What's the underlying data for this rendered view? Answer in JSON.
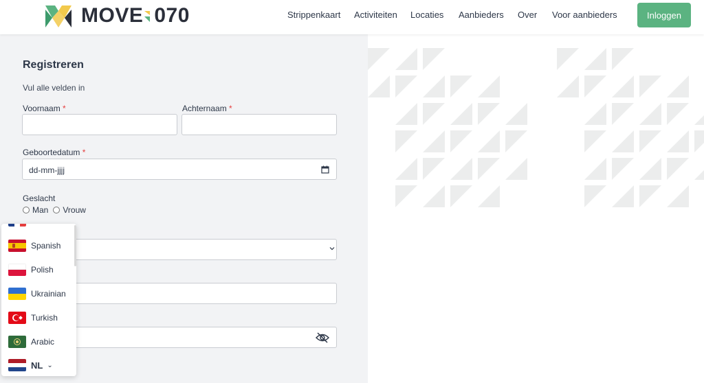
{
  "header": {
    "brand": "MOVE",
    "brand_number": "070",
    "nav": [
      "Strippenkaart",
      "Activiteiten",
      "Locaties",
      "Aanbieders",
      "Over",
      "Voor aanbieders"
    ],
    "login_label": "Inloggen",
    "login_color": "#5bb381"
  },
  "form": {
    "title": "Registreren",
    "subtitle": "Vul alle velden in",
    "first_name_label": "Voornaam",
    "last_name_label": "Achternaam",
    "birthdate_label": "Geboortedatum",
    "birthdate_placeholder": "dd-mm-jjjj",
    "required_mark": "*",
    "gender_label": "Geslacht",
    "gender_options": [
      "Man",
      "Vrouw"
    ]
  },
  "language_menu": {
    "items": [
      "Spanish",
      "Polish",
      "Ukrainian",
      "Turkish",
      "Arabic"
    ],
    "current": "NL"
  },
  "colors": {
    "accent": "#5bb381",
    "required": "#e53e3e",
    "panel_bg": "#f2f3f5",
    "pattern": "#eceded"
  }
}
